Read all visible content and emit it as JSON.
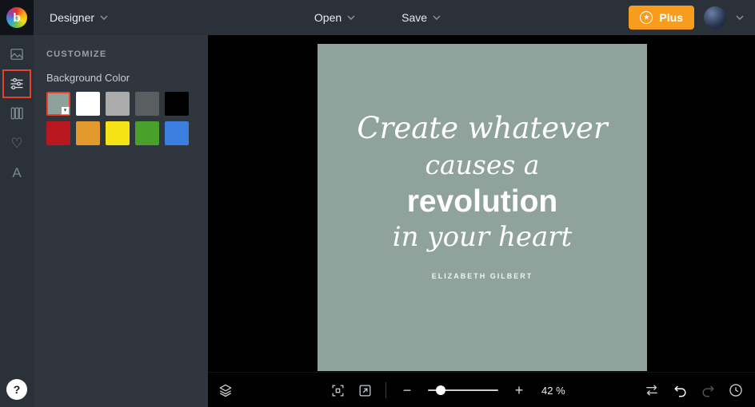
{
  "colors": {
    "accent_orange": "#F79C1D",
    "highlight_red": "#E8402A",
    "artboard_sage": "#8FA29C",
    "topbar_bg": "#2A3138",
    "panel_bg": "#30363D",
    "canvas_bg": "#000000"
  },
  "topbar": {
    "brand_letter": "b",
    "menu_label": "Designer",
    "open_label": "Open",
    "save_label": "Save",
    "plus_label": "Plus"
  },
  "panel": {
    "header": "CUSTOMIZE",
    "section_label": "Background Color",
    "swatches": [
      {
        "name": "sage-green",
        "color": "#8EA29C",
        "selected": true
      },
      {
        "name": "white",
        "color": "#FFFFFF",
        "selected": false
      },
      {
        "name": "light-gray",
        "color": "#ABABAB",
        "selected": false
      },
      {
        "name": "dark-gray",
        "color": "#5B5E60",
        "selected": false
      },
      {
        "name": "black",
        "color": "#000000",
        "selected": false
      },
      {
        "name": "crimson",
        "color": "#B8171F",
        "selected": false
      },
      {
        "name": "amber",
        "color": "#E29A2E",
        "selected": false
      },
      {
        "name": "yellow",
        "color": "#F6E316",
        "selected": false
      },
      {
        "name": "green",
        "color": "#49A12B",
        "selected": false
      },
      {
        "name": "blue",
        "color": "#3B7EE0",
        "selected": false
      }
    ]
  },
  "artboard": {
    "quote_line1": "Create whatever",
    "quote_line2": "causes a",
    "quote_line3": "revolution",
    "quote_line4": "in your heart",
    "attribution": "ELIZABETH GILBERT"
  },
  "toolbar": {
    "zoom_label": "42 %",
    "minus": "−",
    "plus": "+"
  },
  "icons": {
    "heart": "♡",
    "text_tool": "A",
    "help": "?",
    "star": "★",
    "swatch_caret": "▾"
  }
}
